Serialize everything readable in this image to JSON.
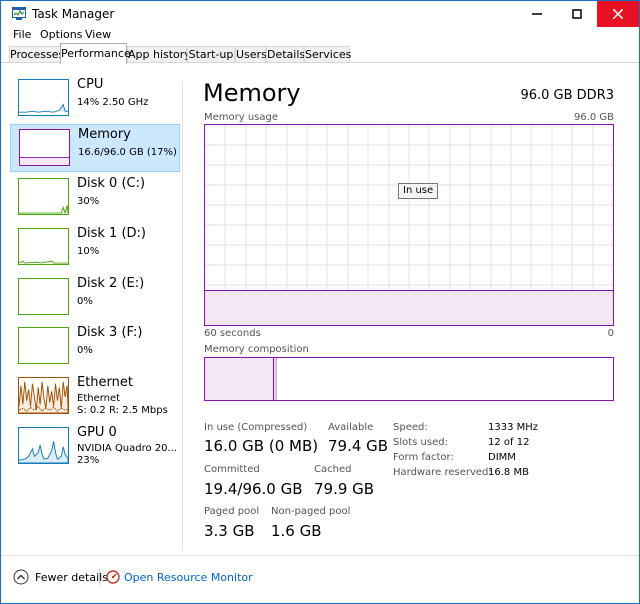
{
  "window": {
    "title": "Task Manager"
  },
  "menu": [
    "File",
    "Options",
    "View"
  ],
  "tabs": [
    {
      "label": "Processes",
      "active": false
    },
    {
      "label": "Performance",
      "active": true
    },
    {
      "label": "App history",
      "active": false
    },
    {
      "label": "Start-up",
      "active": false
    },
    {
      "label": "Users",
      "active": false
    },
    {
      "label": "Details",
      "active": false
    },
    {
      "label": "Services",
      "active": false
    }
  ],
  "sidebar": {
    "items": [
      {
        "title": "CPU",
        "sub1": "14%  2.50 GHz",
        "sub2": "",
        "color": "#117dbb",
        "selected": false
      },
      {
        "title": "Memory",
        "sub1": "16.6/96.0 GB (17%)",
        "sub2": "",
        "color": "#8b12ae",
        "selected": true
      },
      {
        "title": "Disk 0 (C:)",
        "sub1": "30%",
        "sub2": "",
        "color": "#4da60c",
        "selected": false
      },
      {
        "title": "Disk 1 (D:)",
        "sub1": "10%",
        "sub2": "",
        "color": "#4da60c",
        "selected": false
      },
      {
        "title": "Disk 2 (E:)",
        "sub1": "0%",
        "sub2": "",
        "color": "#4da60c",
        "selected": false
      },
      {
        "title": "Disk 3 (F:)",
        "sub1": "0%",
        "sub2": "",
        "color": "#4da60c",
        "selected": false
      },
      {
        "title": "Ethernet",
        "sub1": "Ethernet",
        "sub2": "S: 0.2  R: 2.5 Mbps",
        "color": "#a74f01",
        "selected": false
      },
      {
        "title": "GPU 0",
        "sub1": "NVIDIA Quadro 20...",
        "sub2": "23%",
        "color": "#117dbb",
        "selected": false
      }
    ]
  },
  "main": {
    "title": "Memory",
    "spec": "96.0 GB DDR3",
    "usage_label": "Memory usage",
    "usage_max": "96.0 GB",
    "inuse_tooltip": "In use",
    "time_left": "60 seconds",
    "time_right": "0",
    "composition_label": "Memory composition",
    "stats": {
      "inuse_label": "In use (Compressed)",
      "inuse_value": "16.0 GB (0 MB)",
      "available_label": "Available",
      "available_value": "79.4 GB",
      "committed_label": "Committed",
      "committed_value": "19.4/96.0 GB",
      "cached_label": "Cached",
      "cached_value": "79.9 GB",
      "paged_label": "Paged pool",
      "paged_value": "3.3 GB",
      "nonpaged_label": "Non-paged pool",
      "nonpaged_value": "1.6 GB"
    },
    "specs": {
      "speed_label": "Speed:",
      "speed_value": "1333 MHz",
      "slots_label": "Slots used:",
      "slots_value": "12 of 12",
      "form_label": "Form factor:",
      "form_value": "DIMM",
      "reserved_label": "Hardware reserved:",
      "reserved_value": "16.8 MB"
    }
  },
  "footer": {
    "fewer_details": "Fewer details",
    "resource_monitor": "Open Resource Monitor"
  },
  "colors": {
    "memory": "#8b12ae",
    "cpu": "#117dbb",
    "disk": "#4da60c",
    "ethernet": "#a74f01",
    "close_button": "#e81123",
    "selection": "#cce8ff",
    "link": "#0066cc"
  }
}
